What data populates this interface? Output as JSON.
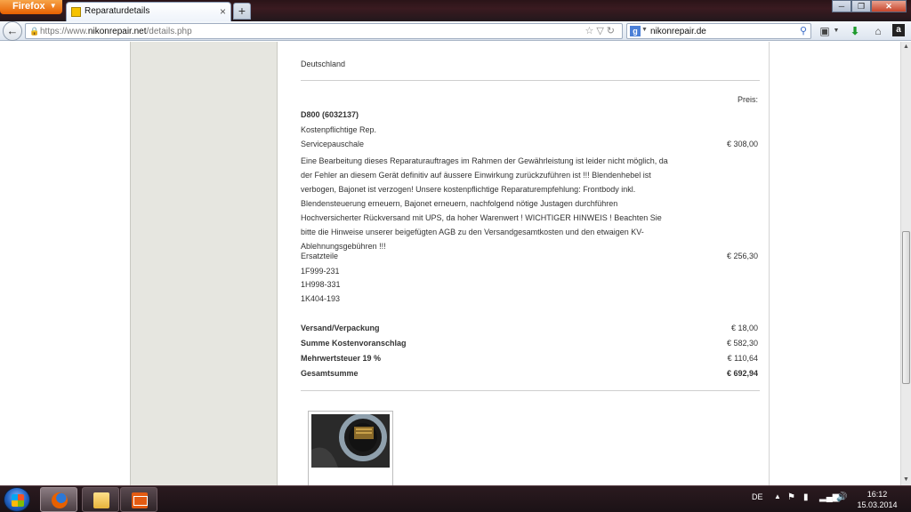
{
  "browser": {
    "menu_button": "Firefox",
    "tab_title": "Reparaturdetails",
    "tab_close": "×",
    "new_tab": "+",
    "url_prefix": "https://www.",
    "url_host": "nikonrepair.net",
    "url_path": "/details.php",
    "search_value": "nikonrepair.de",
    "search_engine_icon": "g-icon",
    "window_buttons": [
      "─",
      "❐",
      "✕"
    ]
  },
  "page": {
    "country": "Deutschland",
    "price_header": "Preis:",
    "model": "D800 (6032137)",
    "category": "Kostenpflichtige Rep.",
    "service_label": "Servicepauschale",
    "service_price": "€ 308,00",
    "description": "Eine Bearbeitung dieses Reparaturauftrages im Rahmen der Gewährleistung ist leider nicht möglich, da der Fehler an diesem Gerät definitiv auf äussere Einwirkung zurückzuführen ist !!! Blendenhebel ist verbogen, Bajonet ist verzogen! Unsere kostenpflichtige Reparaturempfehlung: Frontbody inkl. Blendensteuerung erneuern, Bajonet erneuern, nachfolgend nötige Justagen durchführen Hochversicherter Rückversand mit UPS, da hoher Warenwert ! WICHTIGER HINWEIS ! Beachten Sie bitte die Hinweise unserer beigefügten AGB zu den Versandgesamtkosten und den etwaigen KV-Ablehnungsgebühren !!!",
    "parts_label": "Ersatzteile",
    "parts_price": "€ 256,30",
    "parts": [
      "1F999-231",
      "1H998-331",
      "1K404-193"
    ],
    "totals": [
      {
        "label": "Versand/Verpackung",
        "value": "€ 18,00",
        "bold_value": false
      },
      {
        "label": "Summe Kostenvoranschlag",
        "value": "€ 582,30",
        "bold_value": false
      },
      {
        "label": "Mehrwertsteuer 19 %",
        "value": "€ 110,64",
        "bold_value": false
      },
      {
        "label": "Gesamtsumme",
        "value": "€ 692,94",
        "bold_value": true
      }
    ]
  },
  "taskbar": {
    "language": "DE",
    "time": "16:12",
    "date": "15.03.2014",
    "apps": [
      "firefox-icon",
      "folder-icon",
      "mail-icon"
    ]
  }
}
